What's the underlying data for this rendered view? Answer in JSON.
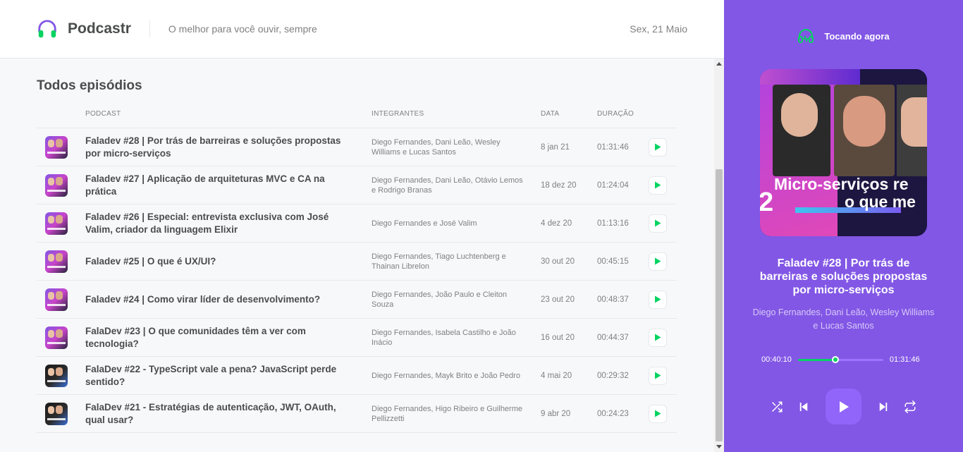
{
  "header": {
    "app_name": "Podcastr",
    "tagline": "O melhor para você ouvir, sempre",
    "date": "Sex, 21 Maio"
  },
  "main": {
    "title": "Todos episódios",
    "columns": {
      "podcast": "PODCAST",
      "members": "INTEGRANTES",
      "date": "DATA",
      "duration": "DURAÇÃO"
    },
    "episodes": [
      {
        "title": "Faladev #28 | Por trás de barreiras e soluções propostas por micro-serviços",
        "members": "Diego Fernandes, Dani Leão, Wesley Williams e Lucas Santos",
        "date": "8 jan 21",
        "duration": "01:31:46"
      },
      {
        "title": "Faladev #27 | Aplicação de arquiteturas MVC e CA na prática",
        "members": "Diego Fernandes, Dani Leão, Otávio Lemos e Rodrigo Branas",
        "date": "18 dez 20",
        "duration": "01:24:04"
      },
      {
        "title": "Faladev #26 | Especial: entrevista exclusiva com José Valim, criador da linguagem Elixir",
        "members": "Diego Fernandes e José Valim",
        "date": "4 dez 20",
        "duration": "01:13:16"
      },
      {
        "title": "Faladev #25 | O que é UX/UI?",
        "members": "Diego Fernandes, Tiago Luchtenberg e Thainan Librelon",
        "date": "30 out 20",
        "duration": "00:45:15"
      },
      {
        "title": "Faladev #24 | Como virar líder de desenvolvimento?",
        "members": "Diego Fernandes, João Paulo e Cleiton Souza",
        "date": "23 out 20",
        "duration": "00:48:37"
      },
      {
        "title": "FalaDev #23 | O que comunidades têm a ver com tecnologia?",
        "members": "Diego Fernandes, Isabela Castilho e João Inácio",
        "date": "16 out 20",
        "duration": "00:44:37"
      },
      {
        "title": "FalaDev #22 - TypeScript vale a pena? JavaScript perde sentido?",
        "members": "Diego Fernandes, Mayk Brito e João Pedro",
        "date": "4 mai 20",
        "duration": "00:29:32"
      },
      {
        "title": "FalaDev #21 - Estratégias de autenticação, JWT, OAuth, qual usar?",
        "members": "Diego Fernandes, Higo Ribeiro e Guilherme Pellizzetti",
        "date": "9 abr 20",
        "duration": "00:24:23"
      }
    ]
  },
  "player": {
    "label": "Tocando agora",
    "cover_caption_line1": "Micro-serviços re",
    "cover_caption_line2": "o que me",
    "cover_number": "2",
    "episode_title": "Faladev #28 | Por trás de barreiras e soluções propostas por micro-serviços",
    "members": "Diego Fernandes, Dani Leão, Wesley Williams e Lucas Santos",
    "current_time": "00:40:10",
    "total_time": "01:31:46",
    "progress_fraction": 0.44,
    "icons": [
      "shuffle-icon",
      "previous-icon",
      "play-icon",
      "next-icon",
      "repeat-icon"
    ]
  },
  "colors": {
    "brand_purple": "#8257e5",
    "accent_green": "#04d361",
    "text": "#494d4b",
    "muted": "#808080"
  }
}
